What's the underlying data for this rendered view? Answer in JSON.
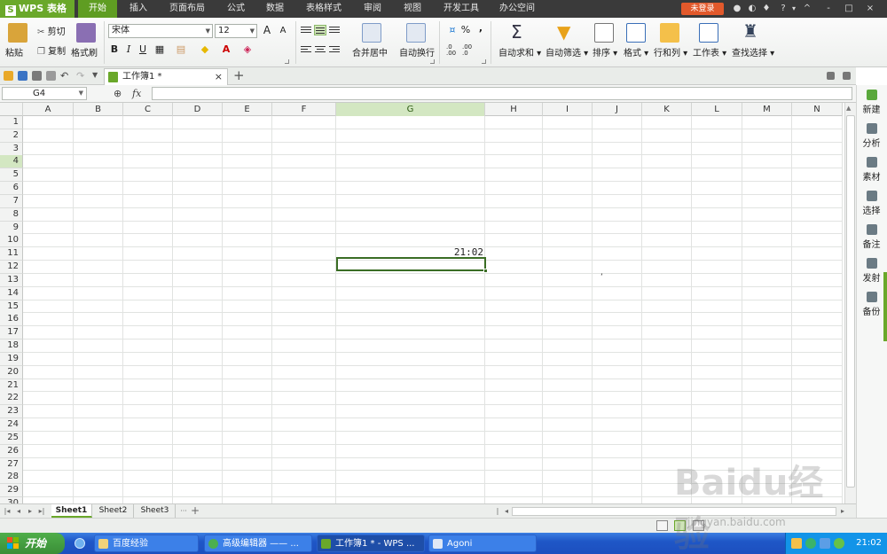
{
  "app": {
    "logo_text": "WPS 表格",
    "login_label": "未登录",
    "menu_tabs": [
      "开始",
      "插入",
      "页面布局",
      "公式",
      "数据",
      "表格样式",
      "审阅",
      "视图",
      "开发工具",
      "办公空间"
    ],
    "active_menu_tab": "开始",
    "window_glyphs": [
      "?",
      "-",
      "^",
      "□",
      "×"
    ]
  },
  "ribbon": {
    "paste_label": "粘贴",
    "cut_label": "剪切",
    "copy_label": "复制",
    "format_painter_label": "格式刷",
    "font_name": "宋体",
    "font_size": "12",
    "bold": "B",
    "italic": "I",
    "underline": "U",
    "grow_font": "A",
    "shrink_font": "A",
    "merge_center_label": "合并居中",
    "wrap_text_label": "自动换行",
    "percent": "%",
    "comma": ",",
    "inc_decimal": ".0 .00",
    "dec_decimal": ".00 .0",
    "autosum_label": "自动求和",
    "autofilter_label": "自动筛选",
    "sort_label": "排序",
    "format_label": "格式",
    "rows_cols_label": "行和列",
    "worksheet_label": "工作表",
    "find_select_label": "查找选择"
  },
  "document": {
    "tab_title": "工作簿1 *",
    "new_tab_glyph": "+"
  },
  "formula_bar": {
    "name_box": "G4",
    "fx_label": "fx",
    "formula": ""
  },
  "sheet": {
    "columns": [
      "A",
      "B",
      "C",
      "D",
      "E",
      "F",
      "G",
      "H",
      "I",
      "J",
      "K",
      "L",
      "M",
      "N"
    ],
    "rows": [
      "1",
      "2",
      "3",
      "4",
      "5",
      "6",
      "7",
      "8",
      "9",
      "10",
      "11",
      "12",
      "13",
      "14",
      "15",
      "16",
      "17",
      "18",
      "19",
      "20",
      "21",
      "22",
      "23",
      "24",
      "25",
      "26",
      "27",
      "28",
      "29",
      "30"
    ],
    "selected_column": "G",
    "selected_row": "4",
    "cells": {
      "G3": "21:02"
    }
  },
  "sheet_tabs": [
    "Sheet1",
    "Sheet2",
    "Sheet3"
  ],
  "active_sheet": "Sheet1",
  "sidebar": {
    "items": [
      "新建",
      "分析",
      "素材",
      "选择",
      "备注",
      "发射",
      "备份"
    ]
  },
  "taskbar": {
    "start_label": "开始",
    "tasks": [
      "百度经验",
      "高级编辑器 —— ...",
      "工作簿1 * - WPS ...",
      "Agoni"
    ],
    "active_task": "工作簿1 * - WPS ...",
    "clock": "21:02"
  },
  "watermark": {
    "brand": "Baidu经验",
    "url": "jingyan.baidu.com"
  },
  "colors": {
    "accent": "#6aa82a",
    "login": "#e2592b",
    "titlebar": "#3a3a3a",
    "taskbar": "#1f57c7"
  }
}
